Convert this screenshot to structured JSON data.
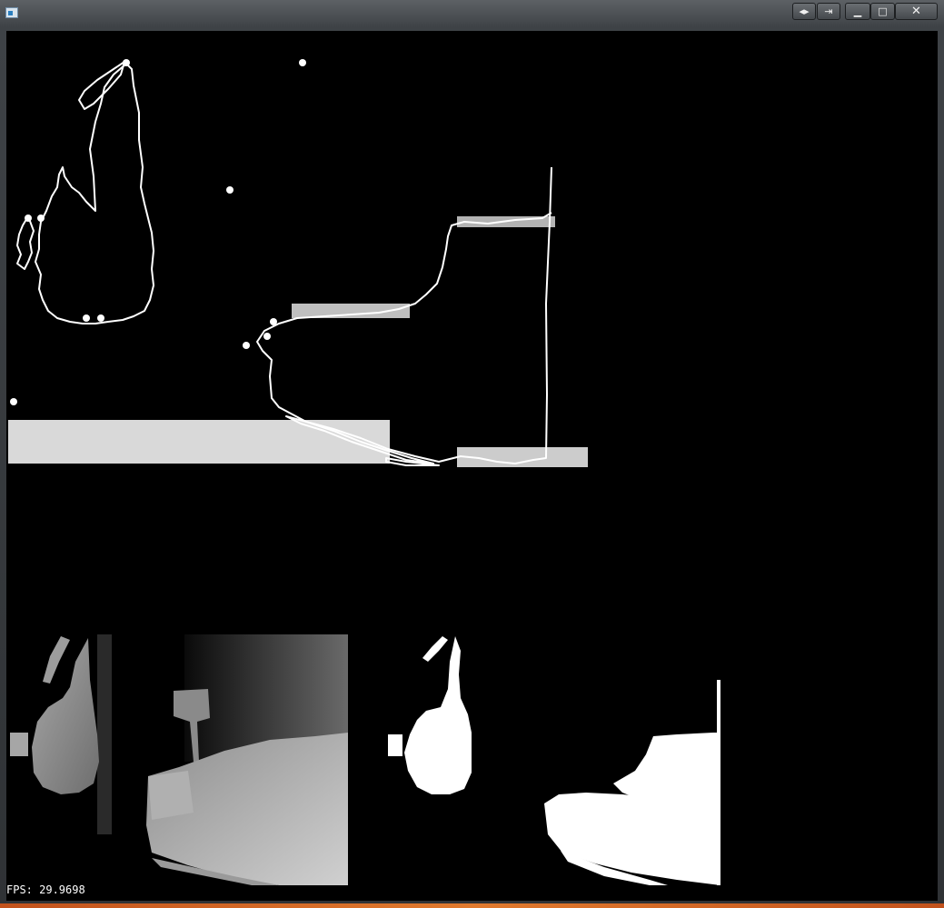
{
  "window": {
    "title": "",
    "buttons": {
      "swap": "◂▸",
      "detach": "⇥",
      "minimize": "▁",
      "maximize": "□",
      "close": "✕"
    }
  },
  "status": {
    "fps_text": "FPS: 29.9698"
  },
  "views": {
    "edge_view": "contour-edges",
    "depth_view": "depth-map",
    "mask_view": "binary-mask"
  },
  "colors": {
    "client_bg": "#000000",
    "edge_stroke": "#ffffff",
    "mask_fill": "#ffffff"
  }
}
